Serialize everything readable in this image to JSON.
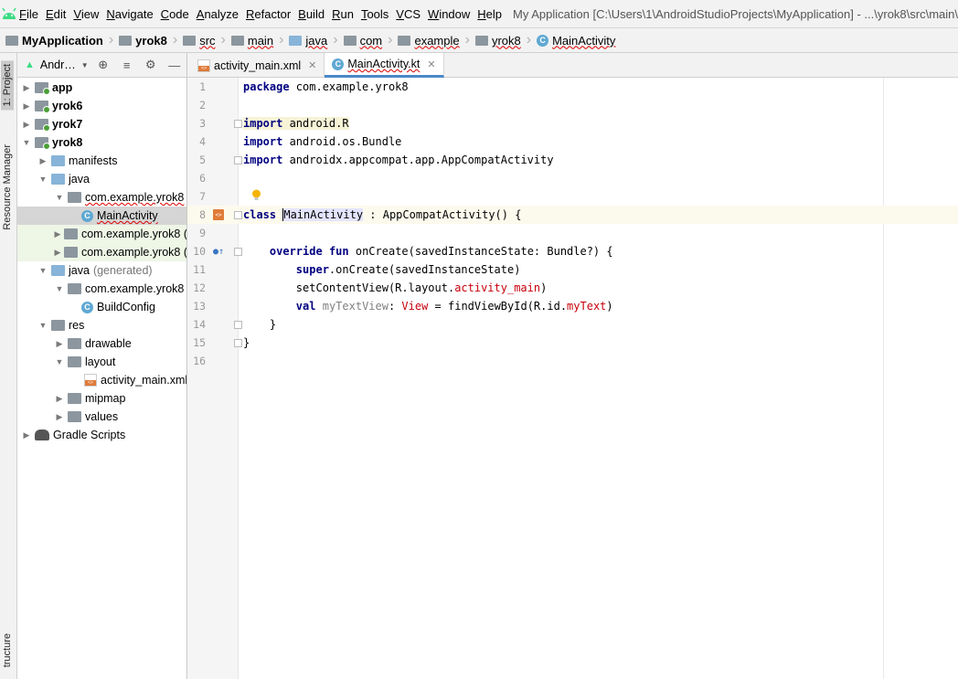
{
  "menubar": {
    "items": [
      "File",
      "Edit",
      "View",
      "Navigate",
      "Code",
      "Analyze",
      "Refactor",
      "Build",
      "Run",
      "Tools",
      "VCS",
      "Window",
      "Help"
    ],
    "window_title": "My Application [C:\\Users\\1\\AndroidStudioProjects\\MyApplication] - ...\\yrok8\\src\\main\\"
  },
  "breadcrumb": {
    "items": [
      "MyApplication",
      "yrok8",
      "src",
      "main",
      "java",
      "com",
      "example",
      "yrok8",
      "MainActivity"
    ]
  },
  "left_stripe": {
    "project_tab": "1: Project",
    "resource_tab": "Resource Manager",
    "structure_tab": "tructure"
  },
  "project_panel": {
    "view_label": "Andr…",
    "tree": [
      {
        "label": "app",
        "bold": true
      },
      {
        "label": "yrok6",
        "bold": true
      },
      {
        "label": "yrok7",
        "bold": true
      },
      {
        "label": "yrok8",
        "bold": true
      },
      {
        "label": "manifests"
      },
      {
        "label": "java"
      },
      {
        "label": "com.example.yrok8"
      },
      {
        "label": "MainActivity"
      },
      {
        "label": "com.example.yrok8 ("
      },
      {
        "label": "com.example.yrok8 ("
      },
      {
        "label": "java",
        "suffix": "(generated)"
      },
      {
        "label": "com.example.yrok8"
      },
      {
        "label": "BuildConfig"
      },
      {
        "label": "res"
      },
      {
        "label": "drawable"
      },
      {
        "label": "layout"
      },
      {
        "label": "activity_main.xml"
      },
      {
        "label": "mipmap"
      },
      {
        "label": "values"
      },
      {
        "label": "Gradle Scripts"
      }
    ]
  },
  "tabs": [
    {
      "label": "activity_main.xml",
      "active": false
    },
    {
      "label": "MainActivity.kt",
      "active": true
    }
  ],
  "editor": {
    "line_numbers": [
      "1",
      "2",
      "3",
      "4",
      "5",
      "6",
      "7",
      "8",
      "9",
      "10",
      "11",
      "12",
      "13",
      "14",
      "15",
      "16"
    ],
    "lines": {
      "l1_kw": "package",
      "l1_rest": " com.example.yrok8",
      "l3_kw": "import",
      "l3_rest": " android.R",
      "l4_kw": "import",
      "l4_rest": " android.os.Bundle",
      "l5_kw": "import",
      "l5_rest": " androidx.appcompat.app.AppCompatActivity",
      "l8_kw": "class",
      "l8_name": "MainActivity",
      "l8_rest": " : AppCompatActivity() {",
      "l10_kw1": "override",
      "l10_kw2": "fun",
      "l10_rest": " onCreate(savedInstanceState: Bundle?) {",
      "l11_kw": "super",
      "l11_rest": ".onCreate(savedInstanceState)",
      "l12_a": "setContentView(R.layout.",
      "l12_b": "activity_main",
      "l12_c": ")",
      "l13_kw": "val",
      "l13_var": "myTextView",
      "l13_colon": ": ",
      "l13_type": "View",
      "l13_mid": " = findViewById(R.id.",
      "l13_id": "myText",
      "l13_end": ")",
      "l14": "}",
      "l15": "}"
    }
  },
  "colors": {
    "keyword": "#000080",
    "accent_tab": "#4a88c7",
    "current_line": "#fcfaed"
  }
}
